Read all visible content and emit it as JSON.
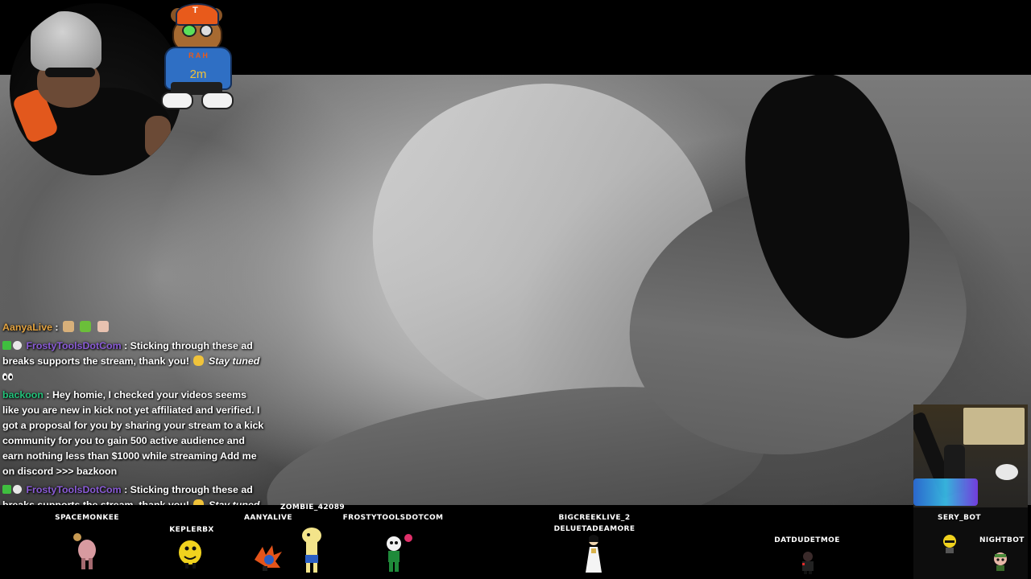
{
  "mascot": {
    "hat_letter": "T",
    "shirt_name": "R A H",
    "timer": "2m"
  },
  "chat": {
    "messages": [
      {
        "user": "AanyaLive",
        "sep": " : ",
        "text": ""
      },
      {
        "user": "FrostyToolsDotCom",
        "sep": " : ",
        "text": "Sticking through these ad breaks supports the stream, thank you! ",
        "italic": "Stay tuned"
      },
      {
        "user": "backoon",
        "sep": " : ",
        "text": "Hey homie, I checked your videos seems like you are new in kick not yet affiliated and verified. I got a proposal for you by sharing your stream to a kick community for you to gain 500 active audience and earn nothing less than $1000 while streaming Add me on discord >>> bazkoon"
      },
      {
        "user": "FrostyToolsDotCom",
        "sep": " : ",
        "text": "Sticking through these ad breaks supports the stream, thank you! ",
        "italic": "Stay tuned"
      }
    ]
  },
  "viewers": [
    {
      "name": "SPACEMONKEE"
    },
    {
      "name": "KEPLERBX"
    },
    {
      "name": "AANYALIVE"
    },
    {
      "name": "ZOMBIE_42089"
    },
    {
      "name": "FROSTYTOOLSDOTCOM"
    },
    {
      "name": "BIGCREEKLIVE_2"
    },
    {
      "name": "DELUETADEAMORE"
    },
    {
      "name": "DATDUDETMOE"
    }
  ],
  "cam2": {
    "labels": [
      "SERY_BOT",
      "NIGHTBOT"
    ]
  },
  "colors": {
    "aanya": "#e4a441",
    "frosty": "#8a5bd6",
    "backoon": "#22c27a"
  }
}
